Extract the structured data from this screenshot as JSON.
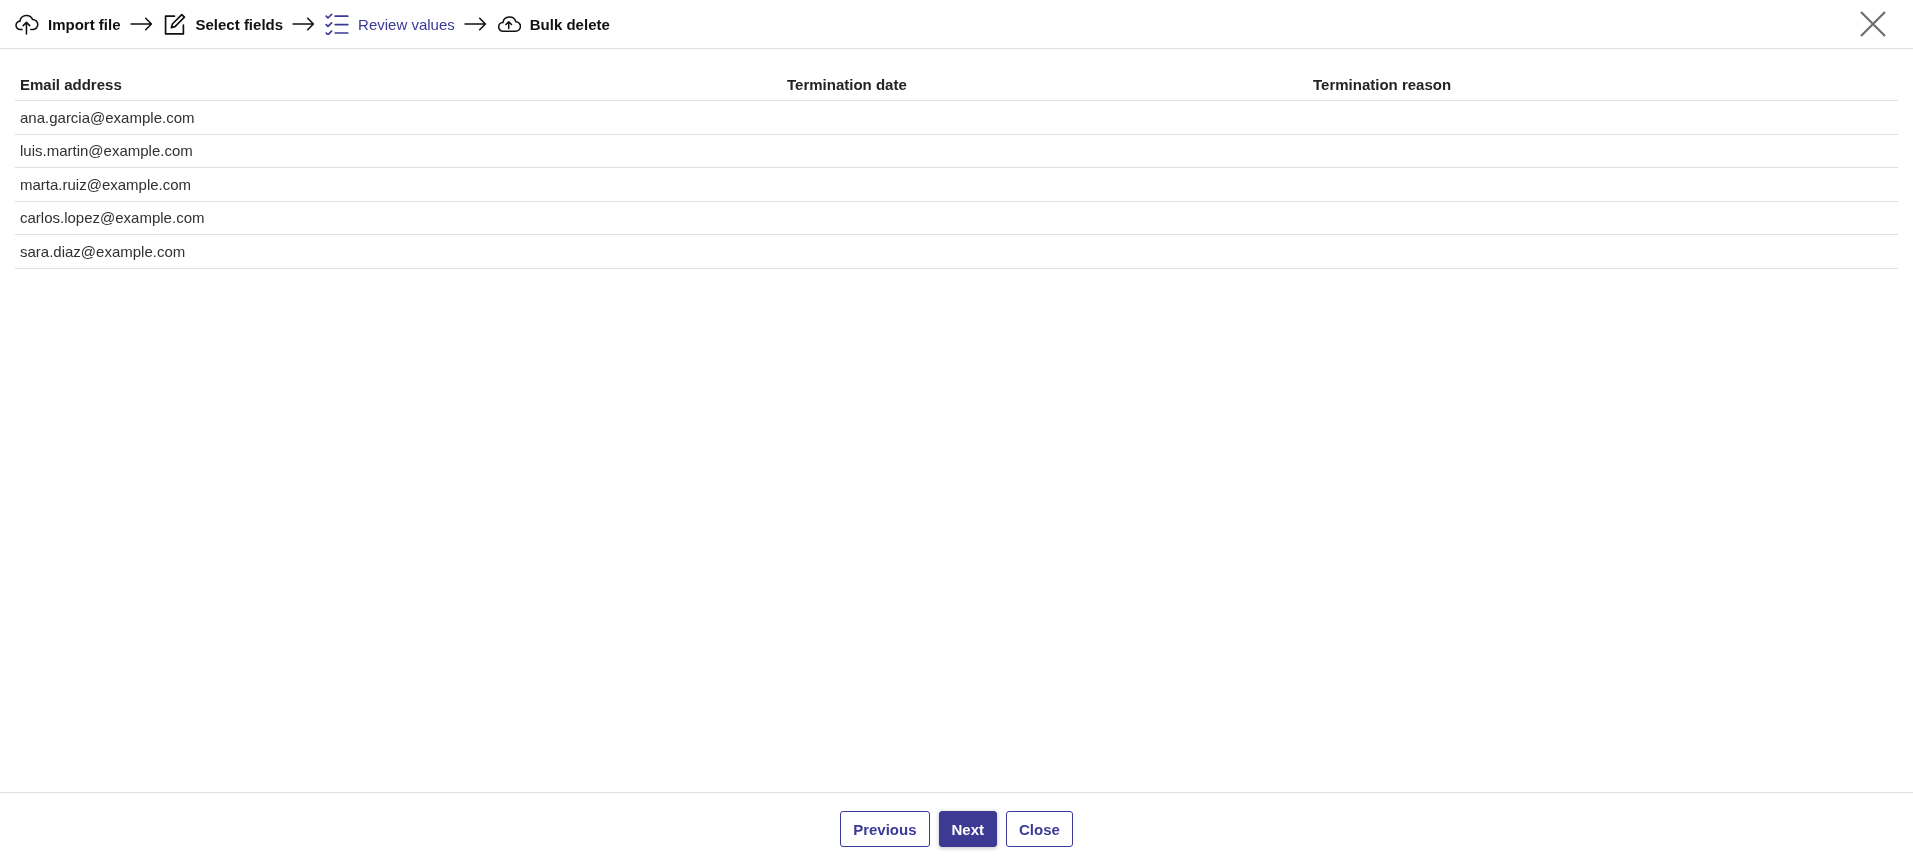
{
  "steps": [
    {
      "label": "Import file",
      "kind": "upload",
      "selected": false
    },
    {
      "label": "Select fields",
      "kind": "edit",
      "selected": false
    },
    {
      "label": "Review values",
      "kind": "checklist",
      "selected": true
    },
    {
      "label": "Bulk delete",
      "kind": "cloud",
      "selected": false
    }
  ],
  "table": {
    "columns": [
      "Email address",
      "Termination date",
      "Termination reason"
    ],
    "rows": [
      [
        "ana.garcia@example.com"
      ],
      [
        "luis.martin@example.com"
      ],
      [
        "marta.ruiz@example.com"
      ],
      [
        "carlos.lopez@example.com"
      ],
      [
        "sara.diaz@example.com"
      ]
    ]
  },
  "buttons": [
    {
      "label": "Previous",
      "kind": "secondary"
    },
    {
      "label": "Next",
      "kind": "primary"
    },
    {
      "label": "Close",
      "kind": "secondary"
    }
  ]
}
